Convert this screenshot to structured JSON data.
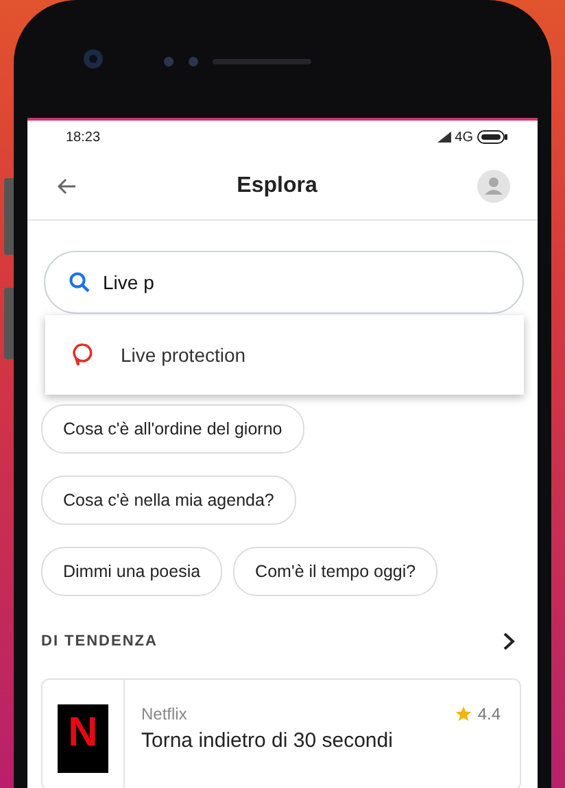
{
  "status_bar": {
    "time": "18:23",
    "network": "4G"
  },
  "header": {
    "title": "Esplora"
  },
  "search": {
    "value": "Live p"
  },
  "suggestions": [
    {
      "label": "Live protection"
    }
  ],
  "chips": [
    {
      "label": "Cosa c'è all'ordine del giorno"
    },
    {
      "label": "Cosa c'è nella mia agenda?"
    },
    {
      "label": "Dimmi una poesia"
    },
    {
      "label": "Com'è il tempo oggi?"
    }
  ],
  "trending": {
    "title": "DI TENDENZA",
    "items": [
      {
        "logo_letter": "N",
        "provider": "Netflix",
        "rating": "4.4",
        "title": "Torna indietro di 30 secondi"
      }
    ]
  }
}
